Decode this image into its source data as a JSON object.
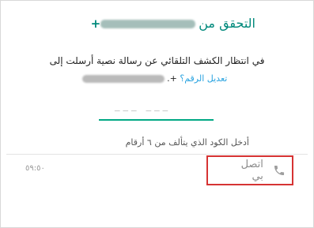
{
  "header": {
    "title_text": "التحقق من",
    "title_phone_prefix": "+"
  },
  "description": {
    "line1": "في انتظار الكشف التلقائي عن رسالة نصية أرسلت إلى",
    "phone_prefix": "+.",
    "edit_link": "تعديل الرقم؟"
  },
  "code_entry": {
    "placeholder": "___ ___"
  },
  "hint": "أدخل الكود الذي يتألف من ٦ أرقام",
  "timer": "٥٩:٥٠",
  "call_button": {
    "label": "اتصل بي",
    "icon": "phone-icon"
  },
  "colors": {
    "accent": "#00897b",
    "underline": "#00a884",
    "link": "#29a3e0",
    "highlight_border": "#d63333"
  }
}
